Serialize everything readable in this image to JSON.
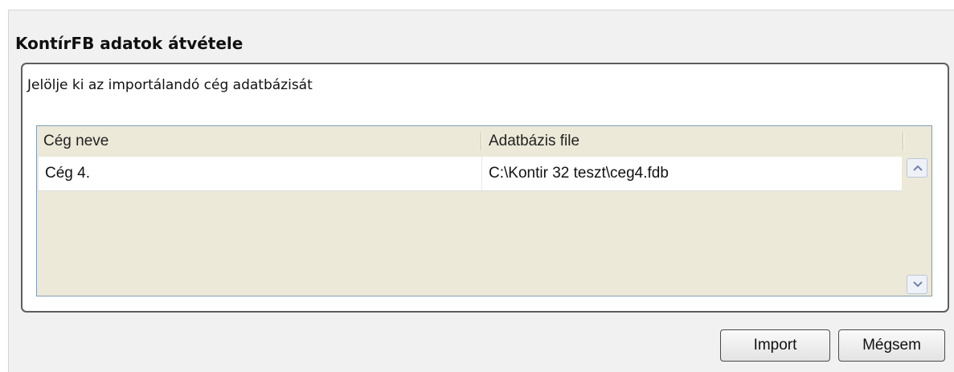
{
  "dialog": {
    "title": "KontírFB adatok átvétele",
    "instruction": "Jelölje ki az importálandó cég adatbázisát"
  },
  "grid": {
    "columns": [
      "Cég neve",
      "Adatbázis file"
    ],
    "rows": [
      [
        "Cég 4.",
        "C:\\Kontir 32 teszt\\ceg4.fdb"
      ]
    ]
  },
  "buttons": {
    "import_label": "Import",
    "cancel_label": "Mégsem"
  },
  "icons": {
    "scroll_up": "scroll-up-arrow",
    "scroll_down": "scroll-down-arrow"
  },
  "colors": {
    "grid_background": "#ece9d8",
    "group_border": "#5e5e5e"
  }
}
